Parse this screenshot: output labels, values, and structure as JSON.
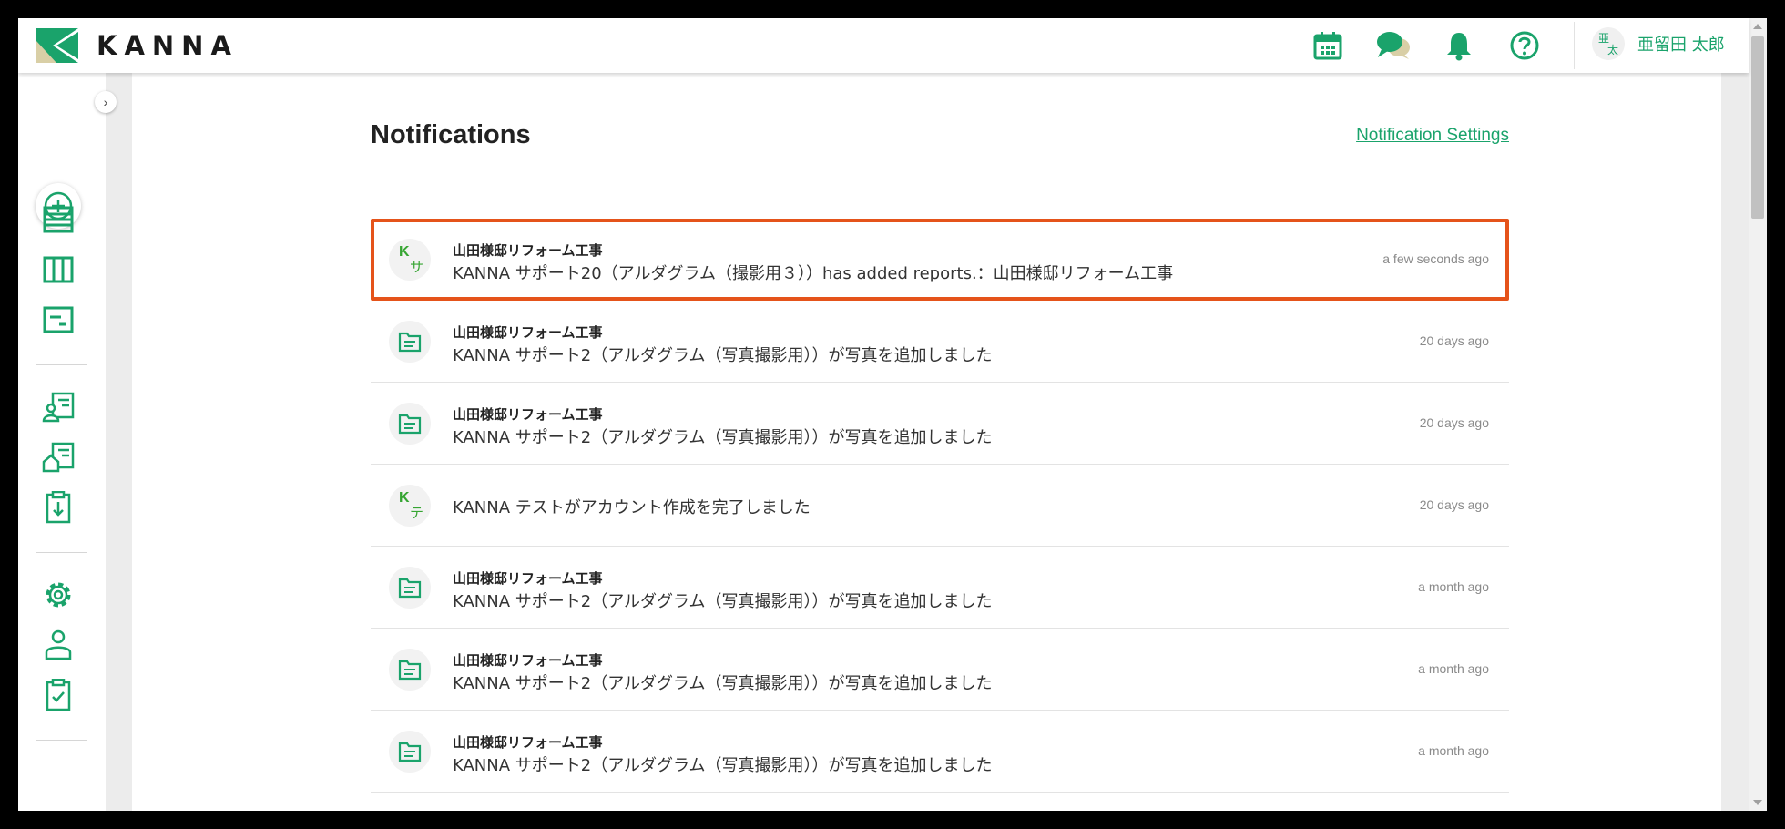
{
  "app": {
    "logo_text": "KANNA",
    "accent_color": "#1aa36b",
    "highlight_color": "#e5531a"
  },
  "header": {
    "icons": [
      "calendar-icon",
      "chat-icon",
      "bell-icon",
      "help-icon"
    ],
    "user": {
      "avatar_chars": [
        "亜",
        "太"
      ],
      "name": "亜留田 太郎"
    }
  },
  "sidebar": {
    "items": [
      "add-icon",
      "list-icon",
      "board-icon",
      "schedule-icon",
      "customer-icon",
      "property-icon",
      "download-icon",
      "settings-icon",
      "user-icon",
      "task-icon"
    ]
  },
  "page": {
    "title": "Notifications",
    "settings_link": "Notification Settings"
  },
  "notifications": [
    {
      "avatar": {
        "type": "initials",
        "k": "K",
        "c": "サ"
      },
      "title": "山田様邸リフォーム工事",
      "message": "KANNA サポート20（アルダグラム（撮影用３））has added reports.：山田様邸リフォーム工事",
      "time": "a few seconds ago",
      "highlighted": true
    },
    {
      "avatar": {
        "type": "doc"
      },
      "title": "山田様邸リフォーム工事",
      "message": "KANNA サポート2（アルダグラム（写真撮影用））が写真を追加しました",
      "time": "20 days ago"
    },
    {
      "avatar": {
        "type": "doc"
      },
      "title": "山田様邸リフォーム工事",
      "message": "KANNA サポート2（アルダグラム（写真撮影用））が写真を追加しました",
      "time": "20 days ago"
    },
    {
      "avatar": {
        "type": "initials",
        "k": "K",
        "c": "テ"
      },
      "title": "",
      "message": "KANNA テストがアカウント作成を完了しました",
      "time": "20 days ago"
    },
    {
      "avatar": {
        "type": "doc"
      },
      "title": "山田様邸リフォーム工事",
      "message": "KANNA サポート2（アルダグラム（写真撮影用））が写真を追加しました",
      "time": "a month ago"
    },
    {
      "avatar": {
        "type": "doc"
      },
      "title": "山田様邸リフォーム工事",
      "message": "KANNA サポート2（アルダグラム（写真撮影用））が写真を追加しました",
      "time": "a month ago"
    },
    {
      "avatar": {
        "type": "doc"
      },
      "title": "山田様邸リフォーム工事",
      "message": "KANNA サポート2（アルダグラム（写真撮影用））が写真を追加しました",
      "time": "a month ago"
    }
  ]
}
